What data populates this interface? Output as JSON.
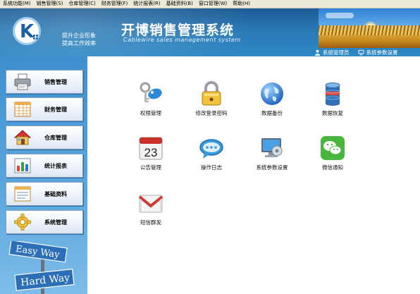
{
  "menubar": {
    "items": [
      {
        "label": "系统功能(M)",
        "icon": "menu-system"
      },
      {
        "label": "销售管理(S)",
        "icon": "menu-sales"
      },
      {
        "label": "仓库管理(C)",
        "icon": "menu-warehouse"
      },
      {
        "label": "财务管理(F)",
        "icon": "menu-finance"
      },
      {
        "label": "统计报表(R)",
        "icon": "menu-report"
      },
      {
        "label": "基础资料(B)",
        "icon": "menu-basic"
      },
      {
        "label": "窗口管理(W)",
        "icon": "menu-window"
      },
      {
        "label": "帮助(H)",
        "icon": "menu-help"
      }
    ]
  },
  "header": {
    "slogan_line1": "提升企业形象",
    "slogan_line2": "提高工作效率",
    "title": "开博销售管理系统",
    "subtitle": "Cablewire sales management system",
    "logo_letter": "K",
    "colors": {
      "banner_top": "#1d5b93",
      "banner_bottom": "#2d88c4"
    }
  },
  "topbar": {
    "user_label": "系统管理员",
    "user_icon": "user-icon",
    "settings_label": "系统参数设置",
    "settings_icon": "monitor-icon"
  },
  "sidebar": {
    "items": [
      {
        "label": "销售管理",
        "icon": "printer-icon"
      },
      {
        "label": "财务管理",
        "icon": "spreadsheet-icon"
      },
      {
        "label": "仓库管理",
        "icon": "house-icon"
      },
      {
        "label": "统计报表",
        "icon": "bar-chart-icon"
      },
      {
        "label": "基础资料",
        "icon": "form-icon"
      },
      {
        "label": "系统管理",
        "icon": "gear-icon"
      }
    ],
    "signs": {
      "top": "Easy Way",
      "bottom": "Hard Way"
    }
  },
  "main": {
    "tiles": [
      {
        "label": "权限管理",
        "icon": "keys-icon"
      },
      {
        "label": "修改登录密码",
        "icon": "padlock-icon"
      },
      {
        "label": "数据备份",
        "icon": "globe-icon"
      },
      {
        "label": "数据恢复",
        "icon": "database-icon"
      },
      {
        "label": "公告管理",
        "icon": "calendar-icon",
        "day": "23"
      },
      {
        "label": "操作日志",
        "icon": "speech-bubble-icon"
      },
      {
        "label": "系统参数设置",
        "icon": "computer-settings-icon"
      },
      {
        "label": "微信通知",
        "icon": "wechat-icon"
      },
      {
        "label": "短信群发",
        "icon": "gmail-icon"
      }
    ]
  }
}
